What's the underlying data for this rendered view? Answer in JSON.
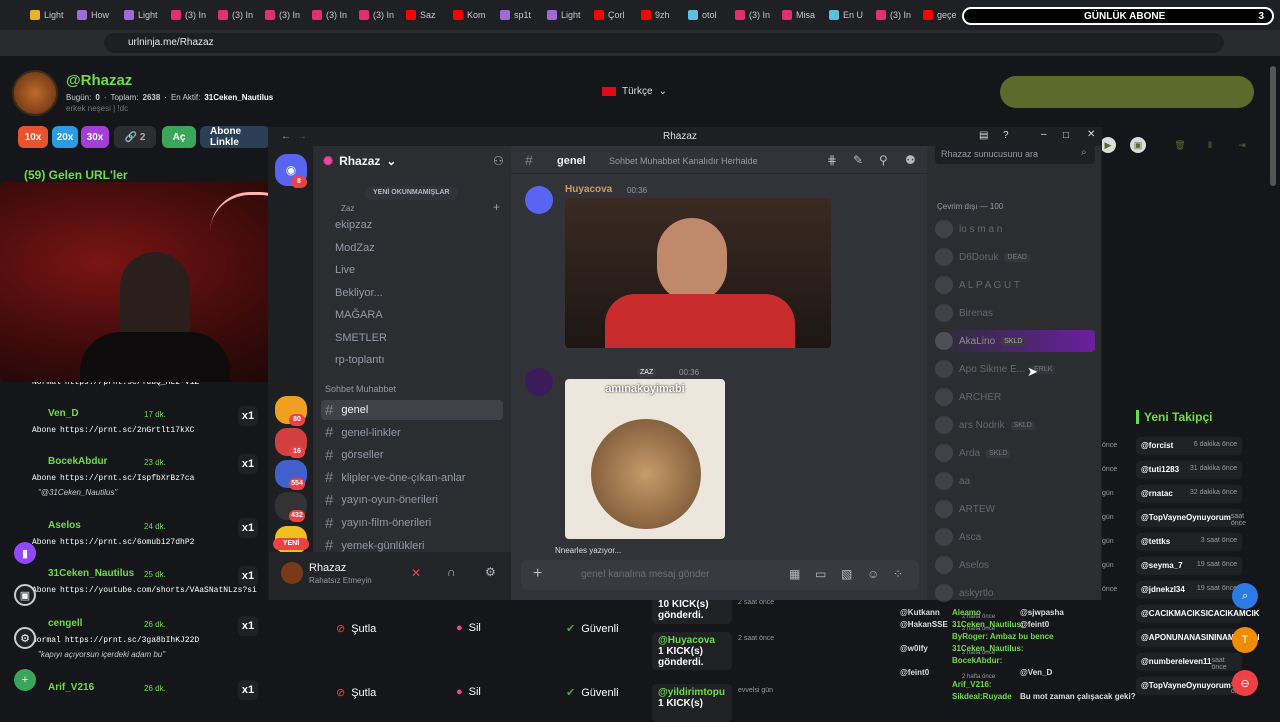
{
  "browser": {
    "tabs": [
      "Light",
      "How",
      "Light",
      "(3) In",
      "(3) In",
      "(3) In",
      "(3) In",
      "(3) In",
      "Saz",
      "Kom",
      "sp1t",
      "Light",
      "Çorl",
      "9zh",
      "otol",
      "(3) In",
      "Misa",
      "En U",
      "(3) In",
      "geçe"
    ],
    "tab_colors": [
      "#e6b422",
      "#a06ad8",
      "#a06ad8",
      "#e1306c",
      "#e1306c",
      "#e1306c",
      "#e1306c",
      "#e1306c",
      "#ff0000",
      "#ff0000",
      "#a06ad8",
      "#a06ad8",
      "#ff0000",
      "#ff0000",
      "#5bc0de",
      "#e1306c",
      "#e1306c",
      "#5bc0de",
      "#e1306c",
      "#ff0000"
    ],
    "url": "urlninja.me/Rhazaz",
    "subscriber_goal": {
      "label": "GÜNLÜK ABONE",
      "count": "3"
    }
  },
  "streamer": {
    "name": "@Rhazaz",
    "stats_today_label": "Bugün:",
    "stats_today": "0",
    "stats_total_label": "Toplam:",
    "stats_total": "2638",
    "most_active_label": "En Aktif:",
    "most_active": "31Ceken_Nautilus",
    "subtitle": "erkek neşesi | !dc",
    "language": "Türkçe"
  },
  "filters": {
    "x10": "10x",
    "x20": "20x",
    "x30": "30x",
    "links": "2",
    "open": "Aç",
    "subs_only": "Abone Linkle"
  },
  "incoming": {
    "title": "(59) Gelen URL'ler",
    "rows": [
      {
        "kind": "Normal",
        "link": "https://prnt.sc/YubQ_HL2-V1Z",
        "user": "",
        "time": "",
        "note": ""
      },
      {
        "kind": "Abone",
        "link": "https://prnt.sc/2nGrtlt17kXC",
        "user": "Ven_D",
        "time": "17 dk.",
        "note": ""
      },
      {
        "kind": "Abone",
        "link": "https://prnt.sc/IspfbXrBz7ca",
        "user": "BocekAbdur",
        "time": "23 dk.",
        "note": "\"@31Ceken_Nautilus\""
      },
      {
        "kind": "Abone",
        "link": "https://prnt.sc/6omubi27dhP2",
        "user": "Aselos",
        "time": "24 dk.",
        "note": ""
      },
      {
        "kind": "Abone",
        "link": "https://youtube.com/shorts/VAaSNatNLzs?si",
        "user": "31Ceken_Nautilus",
        "time": "25 dk.",
        "note": ""
      },
      {
        "kind": "Normal",
        "link": "https://prnt.sc/3ga8bIhKJ22D",
        "user": "cengell",
        "time": "26 dk.",
        "note": "\"kapıyı açıyorsun içerdeki adam bu\""
      },
      {
        "kind": "",
        "link": "",
        "user": "Arif_V216",
        "time": "26 dk.",
        "note": ""
      }
    ],
    "x1": "x1",
    "ban_label": "Şutla",
    "delete_label": "Sil",
    "safe_label": "Güvenli"
  },
  "discord": {
    "window_title": "Rhazaz",
    "server_name": "Rhazaz",
    "unread_banner": "YENİ OKUNMAMIŞLAR",
    "category_zaz": "Zaz",
    "channels_top": [
      "ekipzaz",
      "ModZaz",
      "Live",
      "Bekliyor...",
      "MAĞARA",
      "SMETLER",
      "rp-toplantı"
    ],
    "category_sohbet": "Sohbet Muhabbet",
    "channels": [
      "genel",
      "genel-linkler",
      "görseller",
      "klipler-ve-öne-çıkan-anlar",
      "yayın-oyun-önerileri",
      "yayın-film-önerileri",
      "yemek-günlükleri"
    ],
    "guild_badges": [
      "8",
      "80",
      "16",
      "554",
      "432"
    ],
    "new_label": "YENİ",
    "user_name": "Rhazaz",
    "user_status": "Rahatsız Etmeyin",
    "channel_name": "genel",
    "channel_topic": "Sohbet Muhabbet Kanalıdır Herhalde",
    "search_placeholder": "Rhazaz sunucusunu ara",
    "msg1_author": "Huyacova",
    "msg1_time": "00:36",
    "msg2_tag": "ZAZ",
    "msg2_time": "00:36",
    "gif_caption": "amınakoyimabi",
    "typing": "Nnearles yazıyor...",
    "composer_placeholder": "genel kanalına mesaj gönder",
    "offline_header": "Çevrim dışı — 100",
    "members": [
      {
        "name": "lo s m a n",
        "tag": ""
      },
      {
        "name": "D6Doruk",
        "tag": "DEAD"
      },
      {
        "name": "A L P A G U T",
        "tag": ""
      },
      {
        "name": "Birenas",
        "tag": ""
      },
      {
        "name": "AkaLino",
        "tag": "SKLD"
      },
      {
        "name": "Apo Sikme E...",
        "tag": "ERLK"
      },
      {
        "name": "ARCHER",
        "tag": ""
      },
      {
        "name": "ars Nodrik",
        "tag": "SKLD"
      },
      {
        "name": "Arda",
        "tag": "SKLD"
      },
      {
        "name": "aa",
        "tag": ""
      },
      {
        "name": "ARTEW",
        "tag": ""
      },
      {
        "name": "Asca",
        "tag": ""
      },
      {
        "name": "Aselos",
        "tag": ""
      },
      {
        "name": "askyrtlo",
        "tag": ""
      }
    ]
  },
  "followers": {
    "title": "Yeni Takipçi",
    "rows": [
      {
        "name": "@forcist",
        "time": "6 dakika önce"
      },
      {
        "name": "@tuti1283",
        "time": "31 dakika önce"
      },
      {
        "name": "@rnatac",
        "time": "32 dakika önce"
      },
      {
        "name": "@TopVayneOynuyorum",
        "time": "saat önce"
      },
      {
        "name": "@tettks",
        "time": "3 saat önce"
      },
      {
        "name": "@seyma_7",
        "time": "19 saat önce"
      },
      {
        "name": "@jdnekzl34",
        "time": "19 saat önce"
      },
      {
        "name": "@CACIKMACIKSICACIKAMCIK",
        "time": ""
      },
      {
        "name": "@APONUNANASININAMCIKEN",
        "time": ""
      },
      {
        "name": "@numbereleven11",
        "time": "saat önce"
      },
      {
        "name": "@TopVayneOynuyorum",
        "time": "saat önce"
      }
    ],
    "left_col": [
      {
        "name": "",
        "time": "önce"
      },
      {
        "name": "",
        "time": "önce"
      },
      {
        "name": "",
        "time": "gün"
      },
      {
        "name": "",
        "time": "gün"
      },
      {
        "name": "",
        "time": "gün"
      },
      {
        "name": "",
        "time": "gün"
      },
      {
        "name": "",
        "time": "önce"
      }
    ]
  },
  "kicks": [
    {
      "user": "",
      "text": "10 KICK(s) gönderdi.",
      "time": "2 saat önce"
    },
    {
      "user": "@Huyacova",
      "text": "1 KICK(s) gönderdi.",
      "time": "2 saat önce"
    },
    {
      "user": "@yildirimtopu",
      "text": "1 KICK(s)",
      "time": "evvelsi gün"
    }
  ],
  "bottom_chat": [
    {
      "left": "@Kutkann",
      "mid": "Aleamo",
      "right": "@sjwpasha",
      "time": "2 hafta önce"
    },
    {
      "left": "@HakanSSE",
      "mid": "31Ceken_Nautilus:",
      "right": "@feint0",
      "time": "2 hafta önce"
    },
    {
      "left": "",
      "mid": "ByRoger: Ambaz bu bence",
      "right": "",
      "time": ""
    },
    {
      "left": "@w0lfy",
      "mid": "31Ceken_Nautilus:",
      "right": "",
      "time": "2 hafta önce"
    },
    {
      "left": "",
      "mid": "BocekAbdur:",
      "right": "",
      "time": ""
    },
    {
      "left": "@feint0",
      "mid": "",
      "right": "@Ven_D",
      "time": "2 hafta önce"
    },
    {
      "left": "",
      "mid": "Arif_V216:",
      "right": "",
      "time": ""
    },
    {
      "left": "",
      "mid": "Sikdeal:Ruyade",
      "right": "Bu mot zaman çalışacak geki?",
      "time": ""
    }
  ],
  "colors": {
    "accent_green": "#6fdc45",
    "discord_blurple": "#5865f2",
    "danger": "#ed4245"
  }
}
